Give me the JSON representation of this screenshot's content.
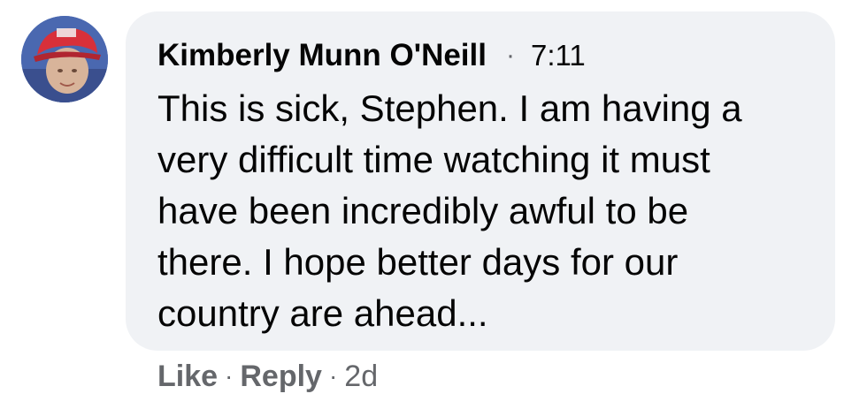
{
  "comment": {
    "author": "Kimberly Munn O'Neill",
    "separator": "·",
    "time": "7:11",
    "text_lines": [
      "This is sick, Stephen. I am having a",
      "very difficult time watching it must",
      "have been incredibly awful to be",
      "there. I hope better days for our",
      "country are ahead..."
    ]
  },
  "actions": {
    "like_label": "Like",
    "reply_label": "Reply",
    "dot": "·",
    "age": "2d"
  },
  "colors": {
    "bubble_bg": "#f0f2f5",
    "text": "#050505",
    "secondary": "#65676b"
  }
}
